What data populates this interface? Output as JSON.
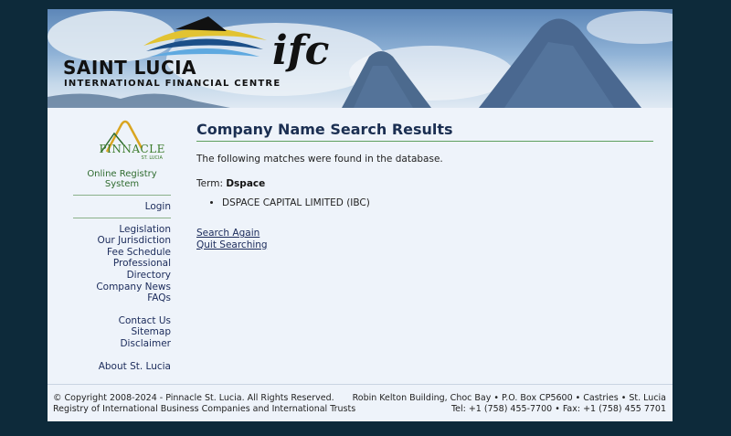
{
  "banner": {
    "brand_main": "SAINT LUCIA",
    "brand_sub": "INTERNATIONAL FINANCIAL CENTRE",
    "brand_ifc": "ifc"
  },
  "sidebar": {
    "logo_word": "PINNACLE",
    "logo_sub": "ST. LUCIA",
    "registry_system": "Online Registry System",
    "login": "Login",
    "group1": [
      "Legislation",
      "Our Jurisdiction",
      "Fee Schedule",
      "Professional Directory",
      "Company News",
      "FAQs"
    ],
    "group2": [
      "Contact Us",
      "Sitemap",
      "Disclaimer"
    ],
    "group3": [
      "About St. Lucia"
    ]
  },
  "main": {
    "title": "Company Name Search Results",
    "intro": "The following matches were found in the database.",
    "term_label": "Term:",
    "term_value": "Dspace",
    "results": [
      "DSPACE CAPITAL LIMITED (IBC)"
    ],
    "search_again": "Search Again",
    "quit_searching": "Quit Searching"
  },
  "footer": {
    "left_line1": "© Copyright 2008-2024 - Pinnacle St. Lucia. All Rights Reserved.",
    "left_line2": "Registry of International Business Companies and International Trusts",
    "right_line1": "Robin Kelton Building, Choc Bay • P.O. Box CP5600 • Castries • St. Lucia",
    "right_line2": "Tel: +1 (758) 455-7700 • Fax: +1 (758) 455 7701"
  }
}
